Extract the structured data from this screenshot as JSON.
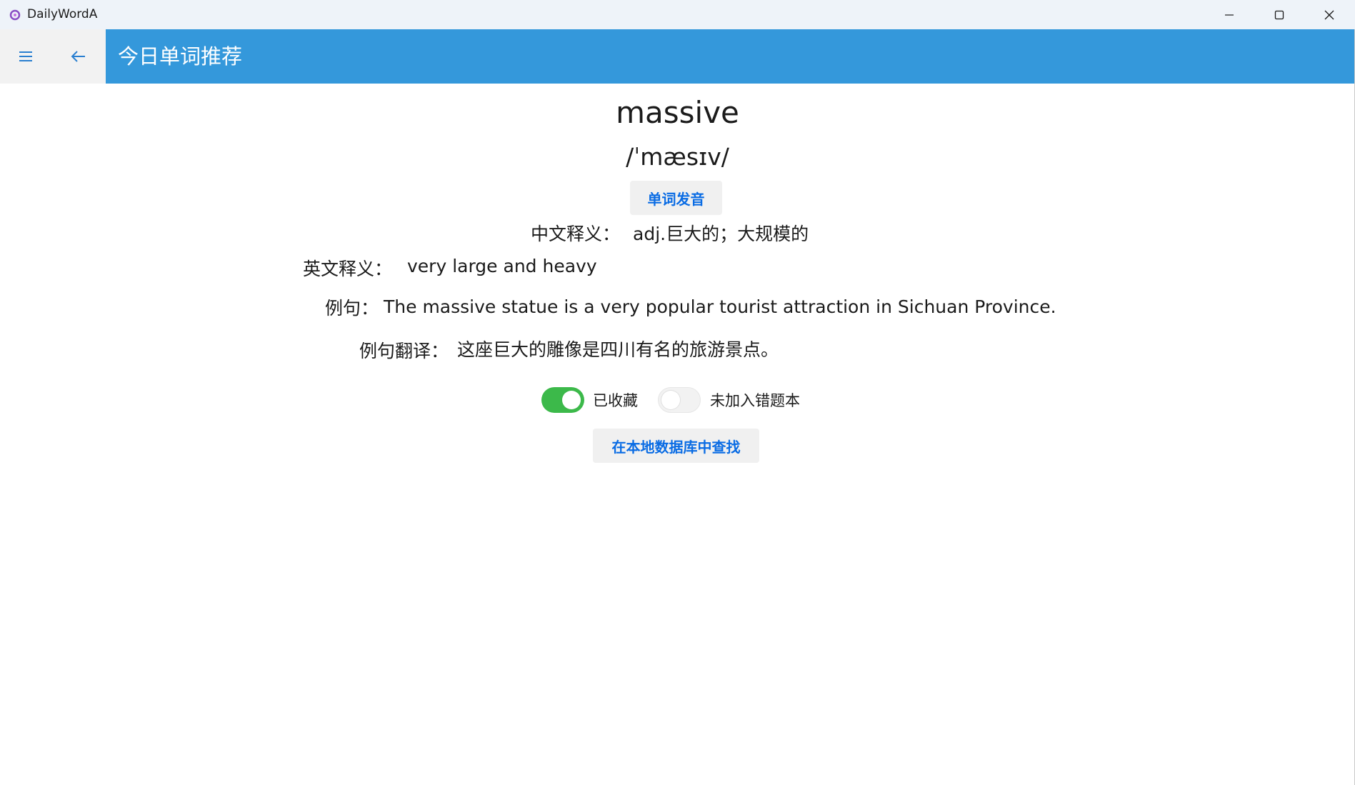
{
  "window": {
    "app_title": "DailyWordA",
    "icons": {
      "app": "app-logo-icon",
      "minimize": "minimize-icon",
      "maximize": "maximize-icon",
      "close": "close-icon"
    }
  },
  "nav": {
    "menu_icon": "hamburger-menu-icon",
    "back_icon": "back-arrow-icon",
    "title": "今日单词推荐"
  },
  "word": {
    "text": "massive",
    "phonetic": "/ˈmæsɪv/",
    "pronounce_button": "单词发音",
    "chinese_label": "中文释义：",
    "chinese_value": "adj.巨大的；大规模的",
    "english_label": "英文释义：",
    "english_value": "very large and heavy",
    "example_label": "例句：",
    "example_value": "The massive statue is a very popular tourist attraction in Sichuan Province.",
    "translation_label": "例句翻译：",
    "translation_value": "这座巨大的雕像是四川有名的旅游景点。"
  },
  "toggles": {
    "favorite": {
      "label": "已收藏",
      "on": true
    },
    "wrong_book": {
      "label": "未加入错题本",
      "on": false
    }
  },
  "search_button": "在本地数据库中查找",
  "colors": {
    "header": "#3498db",
    "toggle_on": "#3cb94a",
    "button_text": "#0a6ce4"
  }
}
